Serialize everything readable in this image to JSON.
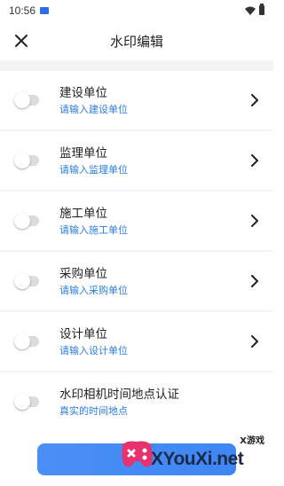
{
  "status_bar": {
    "time": "10:56"
  },
  "header": {
    "title": "水印编辑"
  },
  "rows": [
    {
      "label": "建设单位",
      "hint": "请输入建设单位",
      "enabled": false
    },
    {
      "label": "监理单位",
      "hint": "请输入监理单位",
      "enabled": false
    },
    {
      "label": "施工单位",
      "hint": "请输入施工单位",
      "enabled": false
    },
    {
      "label": "采购单位",
      "hint": "请输入采购单位",
      "enabled": false
    },
    {
      "label": "设计单位",
      "hint": "请输入设计单位",
      "enabled": false
    },
    {
      "label": "水印相机时间地点认证",
      "hint": "真实的时间地点",
      "enabled": false
    }
  ],
  "bottom": {
    "button_label": ""
  },
  "watermark": {
    "brand": "XYouXi.net",
    "tag": "X游戏"
  },
  "colors": {
    "accent": "#2a7de1",
    "button": "#4b8ff5",
    "toggle_off": "#dcdcdc"
  }
}
